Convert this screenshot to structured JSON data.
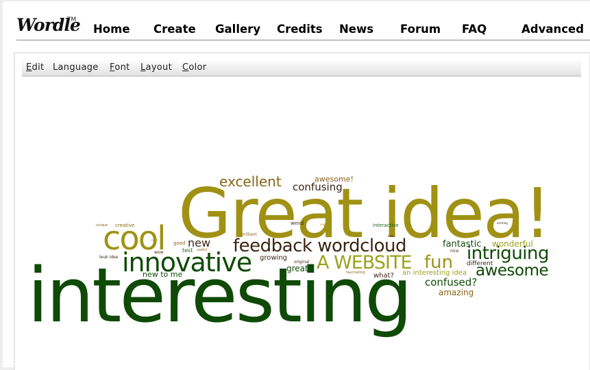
{
  "header": {
    "logo": "Wordle",
    "logo_tm": "TM",
    "nav": [
      "Home",
      "Create",
      "Gallery",
      "Credits",
      "News",
      "Forum",
      "FAQ",
      "Advanced"
    ]
  },
  "menubar": {
    "items": [
      {
        "label": "Edit",
        "mnemonic": "E",
        "rest": "dit"
      },
      {
        "label": "Language",
        "mnemonic": "",
        "rest": "Language"
      },
      {
        "label": "Font",
        "mnemonic": "F",
        "rest": "ont"
      },
      {
        "label": "Layout",
        "mnemonic": "L",
        "rest": "ayout"
      },
      {
        "label": "Color",
        "mnemonic": "C",
        "rest": "olor"
      }
    ]
  },
  "colors": {
    "olive": "#a09114",
    "dark_green": "#0f4a06",
    "brown": "#3c2414",
    "gold_brown": "#8a6416",
    "lime": "#9aa31c",
    "green": "#1b5e1b"
  },
  "cloud": {
    "words": [
      {
        "text": "Great idea!",
        "color": "olive"
      },
      {
        "text": "interesting",
        "color": "dark_green"
      },
      {
        "text": "innovative",
        "color": "dark_green"
      },
      {
        "text": "cool",
        "color": "olive"
      },
      {
        "text": "feedback wordcloud",
        "color": "brown"
      },
      {
        "text": "A WEBSITE",
        "color": "lime"
      },
      {
        "text": "fun",
        "color": "olive"
      },
      {
        "text": "intriguing",
        "color": "dark_green"
      },
      {
        "text": "awesome",
        "color": "dark_green"
      },
      {
        "text": "excellent",
        "color": "gold_brown"
      },
      {
        "text": "confusing",
        "color": "brown"
      },
      {
        "text": "awesome!",
        "color": "gold_brown"
      },
      {
        "text": "fantastic",
        "color": "dark_green"
      },
      {
        "text": "wonderful",
        "color": "lime"
      },
      {
        "text": "confused?",
        "color": "dark_green"
      },
      {
        "text": "amazing",
        "color": "gold_brown"
      },
      {
        "text": "new",
        "color": "brown"
      },
      {
        "text": "new to me",
        "color": "dark_green"
      },
      {
        "text": "great",
        "color": "dark_green"
      },
      {
        "text": "an interesting idea",
        "color": "lime"
      },
      {
        "text": "different",
        "color": "brown"
      },
      {
        "text": "what?",
        "color": "brown"
      },
      {
        "text": "growing",
        "color": "brown"
      },
      {
        "text": "creative",
        "color": "gold_brown"
      },
      {
        "text": "unique",
        "color": "gold_brown"
      },
      {
        "text": "good",
        "color": "gold_brown"
      },
      {
        "text": "test",
        "color": "green"
      },
      {
        "text": "useful",
        "color": "gold_brown"
      },
      {
        "text": "wow",
        "color": "brown"
      },
      {
        "text": "neat",
        "color": "olive"
      },
      {
        "text": "leuk idee",
        "color": "brown"
      },
      {
        "text": "brilliant",
        "color": "gold_brown"
      },
      {
        "text": "weird",
        "color": "brown"
      },
      {
        "text": "super",
        "color": "olive"
      },
      {
        "text": "interactive",
        "color": "green"
      },
      {
        "text": "hello",
        "color": "brown"
      },
      {
        "text": "exciting",
        "color": "brown"
      },
      {
        "text": "nice",
        "color": "brown"
      },
      {
        "text": "original",
        "color": "brown"
      },
      {
        "text": "fascinating",
        "color": "gold_brown"
      }
    ]
  }
}
